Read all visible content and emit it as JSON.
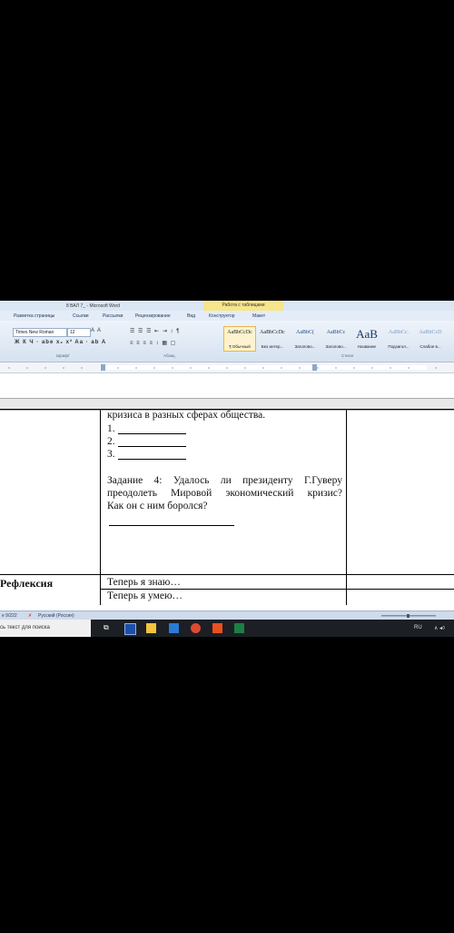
{
  "window": {
    "doc_title": "8 ВАЛ 7_ - Microsoft Word",
    "context_tab": "Работа с таблицами"
  },
  "tabs": [
    "Разметка страницы",
    "Ссылки",
    "Рассылки",
    "Рецензирование",
    "Вид",
    "Конструктор",
    "Макет"
  ],
  "ribbon": {
    "font_name": "Times New Roman",
    "font_size": "12",
    "groups": [
      "Шрифт",
      "Абзац",
      "Стили"
    ],
    "styles": [
      {
        "sample": "AaBbCcDc",
        "name": "¶ Обычный"
      },
      {
        "sample": "AaBbCcDc",
        "name": "Без интер..."
      },
      {
        "sample": "AaBbC(",
        "name": "Заголово..."
      },
      {
        "sample": "AaBbCc",
        "name": "Заголово..."
      },
      {
        "sample": "AaB",
        "name": "Название"
      },
      {
        "sample": "AaBbCc.",
        "name": "Подзагол..."
      },
      {
        "sample": "AaBbCcD",
        "name": "Слабое в..."
      }
    ]
  },
  "document": {
    "task_line": "кризиса в разных сферах общества.",
    "list_items": [
      "1.",
      "2.",
      "3."
    ],
    "task4_lines": [
      "Задание 4: Удалось ли президенту Г.Гуверу",
      "преодолеть Мировой экономический кризис?"
    ],
    "task4_last": "Как он с ним боролся?",
    "reflection_label": "Рефлексия",
    "reflection_lines": [
      "Теперь я знаю…",
      "Теперь я умею…"
    ]
  },
  "statusbar": {
    "words": "е 9/222",
    "language": "Русский (Россия)"
  },
  "taskbar": {
    "search_placeholder": "сь текст для поиска",
    "tray_lang": "RU",
    "tray_icons": "∧ ◂◊"
  }
}
